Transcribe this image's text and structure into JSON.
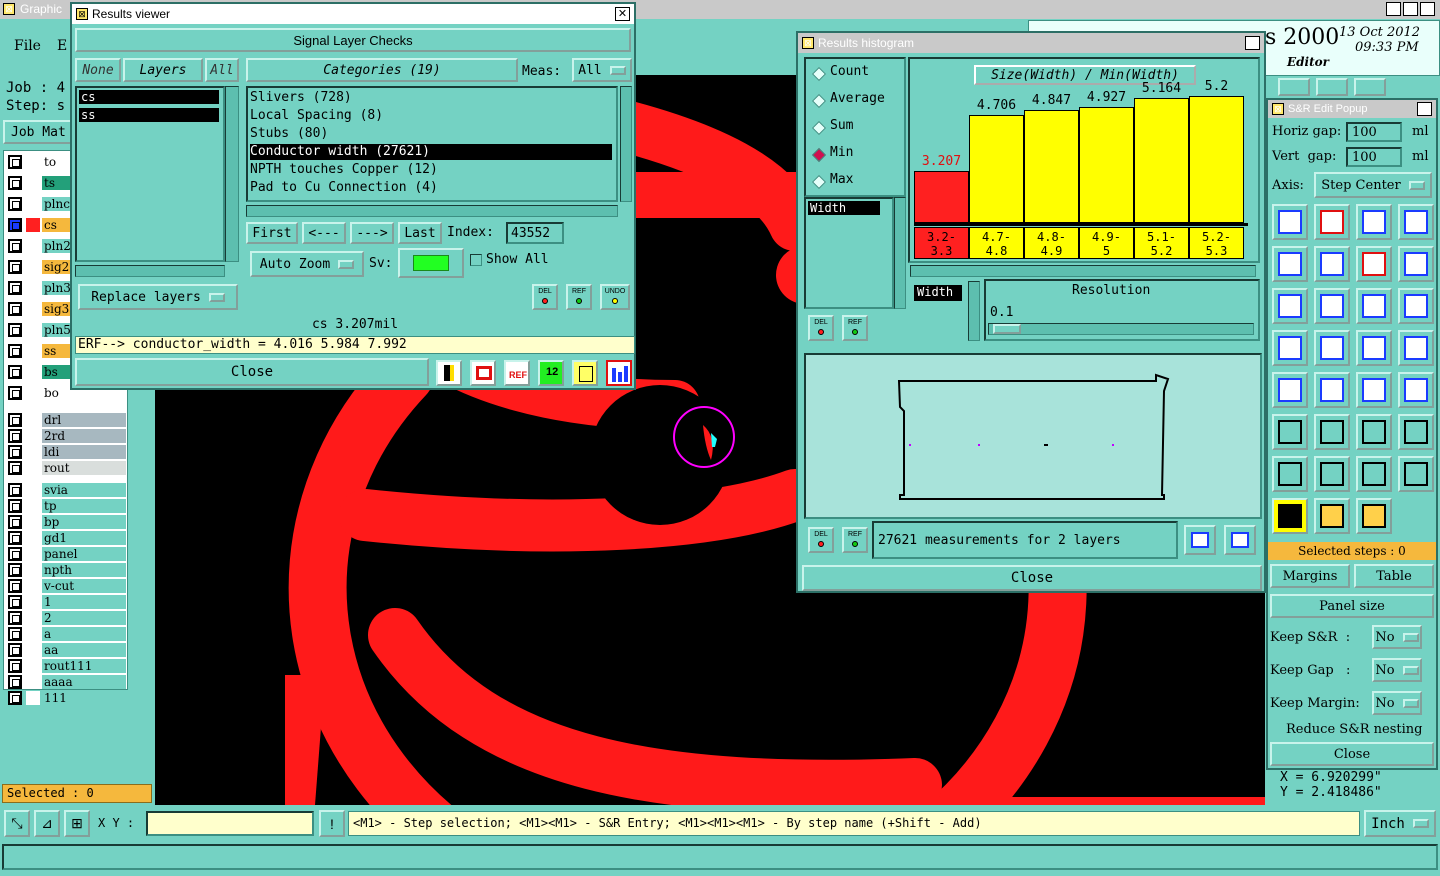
{
  "main_window": {
    "title": "Graphic",
    "menu": [
      "File",
      "E"
    ],
    "job_label": "Job : 4",
    "step_label": "Step: s",
    "job_matrix_btn": "Job Mat",
    "selected_text": "Selected : 0",
    "layers": [
      {
        "name": "to",
        "color": "#ffffff"
      },
      {
        "name": "ts",
        "color": "#23a07a"
      },
      {
        "name": "plnc",
        "color": "#74d2c3"
      },
      {
        "name": "cs",
        "color": "#f5b83d"
      },
      {
        "name": "pln2",
        "color": "#74d2c3"
      },
      {
        "name": "sig2",
        "color": "#f5b83d"
      },
      {
        "name": "pln3",
        "color": "#74d2c3"
      },
      {
        "name": "sig3",
        "color": "#f5b83d"
      },
      {
        "name": "pln5",
        "color": "#74d2c3"
      },
      {
        "name": "ss",
        "color": "#f5b83d"
      },
      {
        "name": "bs",
        "color": "#23a07a"
      },
      {
        "name": "bo",
        "color": "#ffffff"
      },
      {
        "name": "drl",
        "color": "#a7b8c0"
      },
      {
        "name": "2rd",
        "color": "#a7b8c0"
      },
      {
        "name": "ldi",
        "color": "#a7b8c0"
      },
      {
        "name": "rout",
        "color": "#d9dedc"
      },
      {
        "name": "svia",
        "color": "#74d2c3"
      },
      {
        "name": "tp",
        "color": "#74d2c3"
      },
      {
        "name": "bp",
        "color": "#74d2c3"
      },
      {
        "name": "gd1",
        "color": "#74d2c3"
      },
      {
        "name": "panel",
        "color": "#74d2c3"
      },
      {
        "name": "npth",
        "color": "#74d2c3"
      },
      {
        "name": "v-cut",
        "color": "#74d2c3"
      },
      {
        "name": "1",
        "color": "#74d2c3"
      },
      {
        "name": "2",
        "color": "#74d2c3"
      },
      {
        "name": "a",
        "color": "#74d2c3"
      },
      {
        "name": "aa",
        "color": "#74d2c3"
      },
      {
        "name": "rout111",
        "color": "#74d2c3"
      },
      {
        "name": "aaaa",
        "color": "#74d2c3"
      },
      {
        "name": "111",
        "color": "#74d2c3"
      }
    ],
    "xy_label": "X Y :",
    "status_hint": "<M1> - Step selection; <M1><M1> - S&R Entry; <M1><M1><M1> - By step name (+Shift - Add)",
    "units": "Inch",
    "brand": "s 2000",
    "date": "13 Oct 2012",
    "time": "09:33 PM",
    "editor_label": "Editor",
    "coord_x": "X = 6.920299\"",
    "coord_y": "Y = 2.418486\""
  },
  "results_viewer": {
    "title": "Results viewer",
    "section_title": "Signal Layer Checks",
    "none_btn": "None",
    "layers_btn": "Layers",
    "all_btn": "All",
    "layers": [
      "cs",
      "ss"
    ],
    "categories_header": "Categories (19)",
    "meas_label": "Meas:",
    "meas_value": "All",
    "categories": [
      "Slivers (728)",
      "Local Spacing (8)",
      "Stubs (80)",
      "Conductor width (27621)",
      "NPTH touches Copper (12)",
      "Pad to Cu Connection (4)"
    ],
    "first_btn": "First",
    "prev_btn": "<---",
    "next_btn": "--->",
    "last_btn": "Last",
    "index_label": "Index:",
    "index_value": "43552",
    "auto_zoom": "Auto Zoom",
    "sv_label": "Sv:",
    "show_all": "Show All",
    "replace_layers": "Replace layers",
    "del_label": "DEL",
    "ref_label": "REF",
    "undo_label": "UNDO",
    "measure_text": "cs 3.207mil",
    "erf_text": "ERF--> conductor_width = 4.016 5.984 7.992",
    "close": "Close"
  },
  "histogram": {
    "title": "Results histogram",
    "stat_options": [
      "Count",
      "Average",
      "Sum",
      "Min",
      "Max"
    ],
    "selected_stat": "Min",
    "measure_item": "Width",
    "chart_title": "Size(Width) / Min(Width)",
    "resolution_label": "Resolution",
    "resolution_value": "0.1",
    "width_tag": "Width",
    "summary": "27621 measurements for 2 layers",
    "close": "Close",
    "del_label": "DEL",
    "ref_label": "REF"
  },
  "chart_data": {
    "type": "bar",
    "title": "Size(Width) / Min(Width)",
    "categories": [
      "3.2-3.3",
      "4.7-4.8",
      "4.8-4.9",
      "4.9-5",
      "5.1-5.2",
      "5.2-5.3"
    ],
    "category_top": [
      "3.2-",
      "4.7-",
      "4.8-",
      "4.9-",
      "5.1-",
      "5.2-"
    ],
    "category_bottom": [
      "3.3",
      "4.8",
      "4.9",
      "5",
      "5.2",
      "5.3"
    ],
    "value_labels": [
      "3.207",
      "4.706",
      "4.847",
      "4.927",
      "5.164",
      "5.2"
    ],
    "values": [
      3.207,
      4.706,
      4.847,
      4.927,
      5.164,
      5.2
    ],
    "colors": [
      "#ff2020",
      "#ffff00",
      "#ffff00",
      "#ffff00",
      "#ffff00",
      "#ffff00"
    ],
    "ylim": [
      1.8,
      5.4
    ]
  },
  "sr_popup": {
    "title": "S&R Edit Popup",
    "horiz_label": "Horiz gap:",
    "horiz_value": "100",
    "vert_label": "Vert  gap:",
    "vert_value": "100",
    "unit": "ml",
    "axis_label": "Axis:",
    "axis_value": "Step Center",
    "selected_steps": "Selected steps : 0",
    "margins": "Margins",
    "table": "Table",
    "panel_size": "Panel size",
    "keep_sr_label": "Keep S&R  :",
    "keep_sr_value": "No",
    "keep_gap_label": "Keep Gap   :",
    "keep_gap_value": "No",
    "keep_margin_label": "Keep Margin:",
    "keep_margin_value": "No",
    "reduce": "Reduce S&R nesting",
    "close": "Close"
  }
}
